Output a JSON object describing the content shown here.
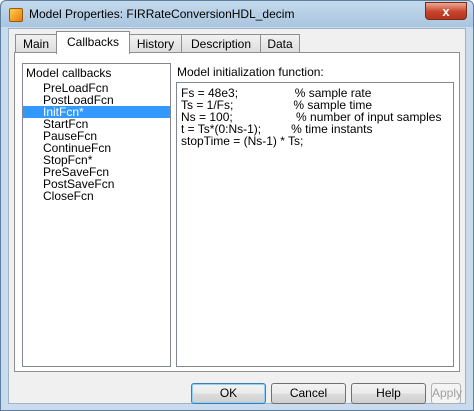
{
  "window": {
    "title": "Model Properties: FIRRateConversionHDL_decim",
    "close_label": "x"
  },
  "tabs": [
    {
      "label": "Main"
    },
    {
      "label": "Callbacks",
      "active": true
    },
    {
      "label": "History"
    },
    {
      "label": "Description"
    },
    {
      "label": "Data"
    }
  ],
  "callbacks": {
    "header": "Model callbacks",
    "items": [
      "PreLoadFcn",
      "PostLoadFcn",
      "InitFcn*",
      "StartFcn",
      "PauseFcn",
      "ContinueFcn",
      "StopFcn*",
      "PreSaveFcn",
      "PostSaveFcn",
      "CloseFcn"
    ],
    "selected": "InitFcn*"
  },
  "editor": {
    "label": "Model initialization function:",
    "lines": [
      "Fs = 48e3;                 % sample rate",
      "Ts = 1/Fs;                  % sample time",
      "Ns = 100;                   % number of input samples",
      "t = Ts*(0:Ns-1);         % time instants",
      "stopTime = (Ns-1) * Ts;"
    ]
  },
  "buttons": {
    "ok": "OK",
    "cancel": "Cancel",
    "help": "Help",
    "apply": "Apply"
  },
  "colors": {
    "selection": "#3399ff",
    "title_gradient": "#aac5df"
  }
}
